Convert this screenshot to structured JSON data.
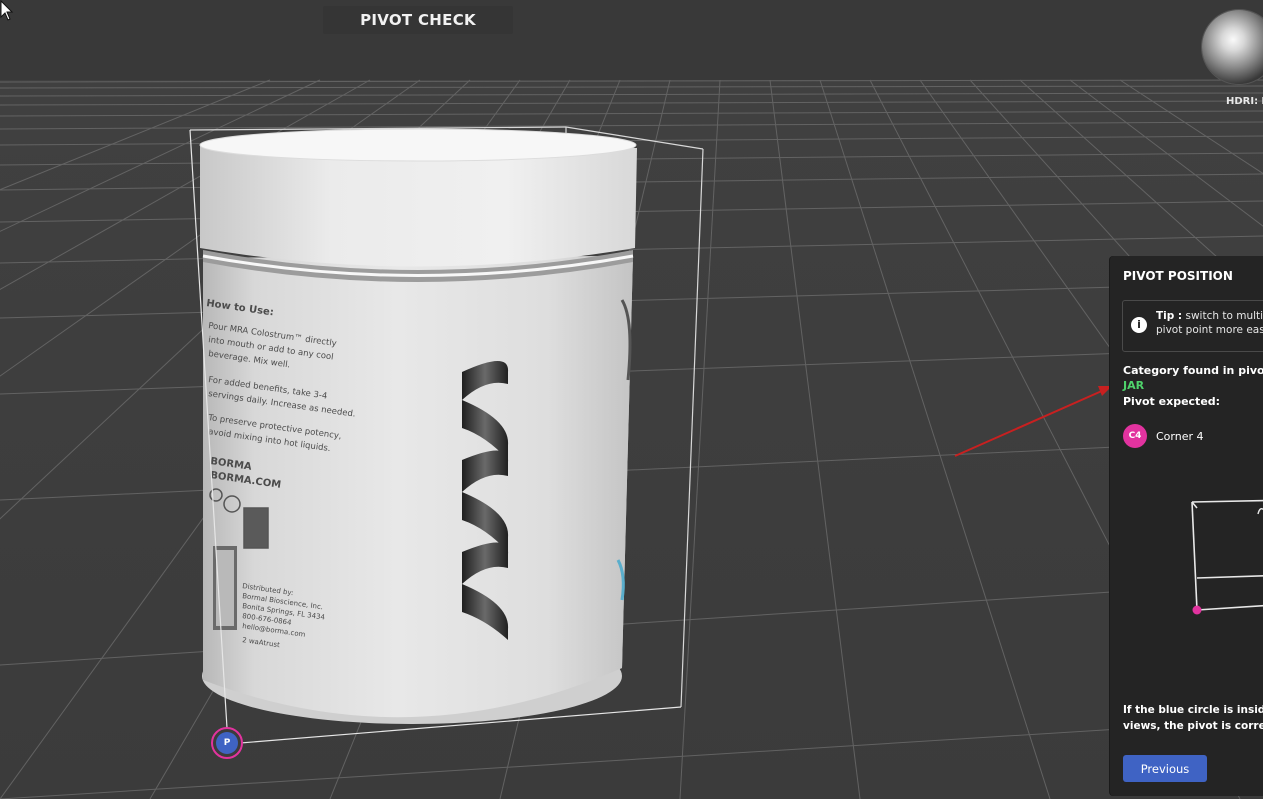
{
  "header": {
    "title": "PIVOT CHECK"
  },
  "hdri": {
    "label_key": "HDRI:",
    "label_value": "N"
  },
  "panel": {
    "title": "PIVOT POSITION",
    "tip": {
      "prefix": "Tip :",
      "text": "switch to multivie",
      "text2": "pivot point more easily"
    },
    "category_label": "Category found in pivot da",
    "category_value": "JAR",
    "pivot_expected_label": "Pivot expected:",
    "corner": {
      "badge": "C4",
      "label": "Corner 4"
    },
    "footnote": "If the blue circle  is inside th views, the pivot is correct.",
    "previous_button": "Previous"
  },
  "pivot_marker": {
    "label": "P"
  },
  "colors": {
    "accent_pink": "#e2339f",
    "accent_blue": "#3f63c4",
    "category_green": "#4fd36b",
    "arrow_red": "#c82020"
  },
  "label_text": {
    "heading": "How to Use:",
    "lines": [
      "Pour MRA Colostrum™ directly",
      "into mouth or add to any cool",
      "beverage. Mix well.",
      "For added benefits, take 3-4",
      "servings daily. Increase as needed.",
      "To preserve protective potency,",
      "avoid mixing into hot liquids."
    ],
    "brand_lines": [
      "BORMA",
      "BORMA.COM"
    ],
    "dist_lines": [
      "Distributed by:",
      "Bormal Bioscience, Inc.",
      "Bonita Springs, FL 3434",
      "800-676-0864",
      "hello@borma.com",
      "2 waAtrust"
    ]
  }
}
